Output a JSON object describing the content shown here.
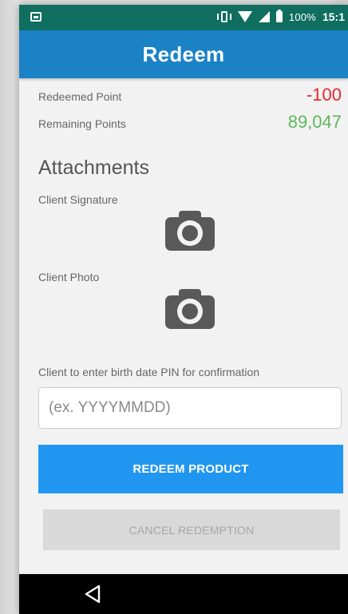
{
  "status_bar": {
    "battery_text": "100%",
    "time": "15:1"
  },
  "app_bar": {
    "title": "Redeem"
  },
  "points": {
    "redeemed_label": "Redeemed Point",
    "redeemed_value": "-100",
    "remaining_label": "Remaining Points",
    "remaining_value": "89,047"
  },
  "attachments": {
    "title": "Attachments",
    "signature_label": "Client Signature",
    "photo_label": "Client Photo"
  },
  "pin": {
    "label": "Client to enter birth date PIN for confirmation",
    "placeholder": "(ex. YYYYMMDD)",
    "value": ""
  },
  "actions": {
    "redeem_label": "REDEEM PRODUCT",
    "cancel_label": "CANCEL REDEMPTION"
  },
  "icons": {
    "camera": "camera-icon",
    "back": "back-triangle-icon"
  },
  "colors": {
    "status_bar": "#0f6e5f",
    "app_bar": "#1a82c5",
    "negative": "#e8262b",
    "positive": "#5cb85c",
    "primary_button": "#2196f0",
    "disabled_button": "#d9d9d9"
  }
}
